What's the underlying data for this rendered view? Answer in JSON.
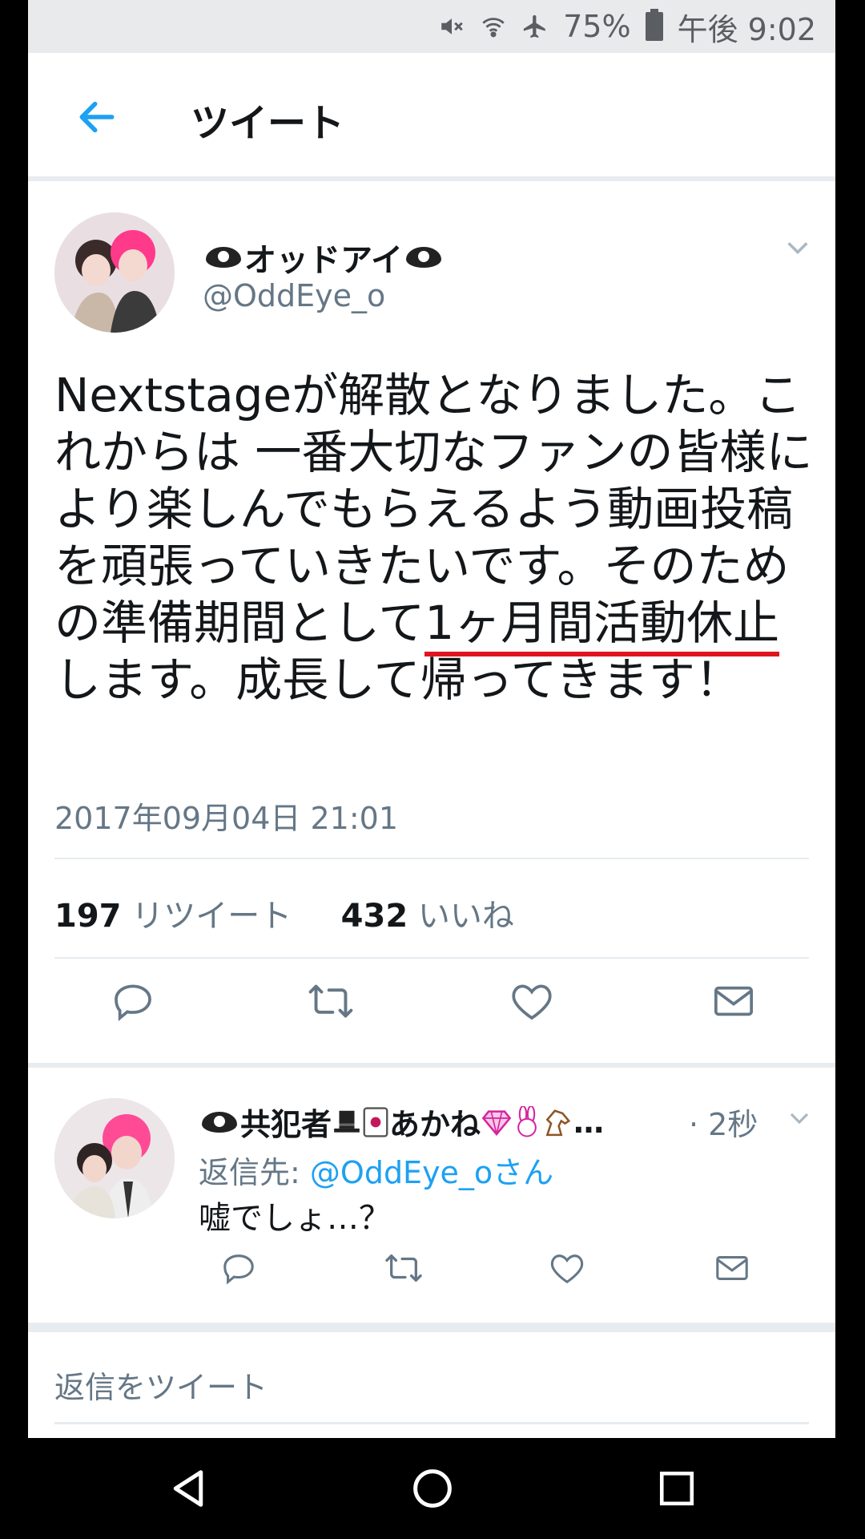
{
  "status_bar": {
    "battery": "75%",
    "time": "午後 9:02"
  },
  "app_bar": {
    "title": "ツイート"
  },
  "tweet": {
    "display_name": "オッドアイ",
    "handle": "@OddEye_o",
    "text_part1": "Nextstageが解散となりました。これからは 一番大切なファンの皆様に より楽しんでもらえるよう動画投稿を頑張っていきたいです。そのための準備期間として",
    "text_highlight": "1ヶ月間活動休止",
    "text_part2": "します。成長して帰ってきます！",
    "timestamp": "2017年09月04日 21:01",
    "retweet_count": "197",
    "retweet_label": "リツイート",
    "like_count": "432",
    "like_label": "いいね"
  },
  "reply": {
    "display_name": "共犯者",
    "display_name_2": "あかね",
    "ellipsis": "…",
    "time": "· 2秒",
    "reply_to_label": "返信先:",
    "reply_to_handle": "@OddEye_oさん",
    "text": "嘘でしょ…？"
  },
  "composer": {
    "placeholder": "返信をツイート"
  },
  "colors": {
    "accent": "#1da1f2",
    "secondary_text": "#657786",
    "annotation_red": "#e0141e"
  }
}
